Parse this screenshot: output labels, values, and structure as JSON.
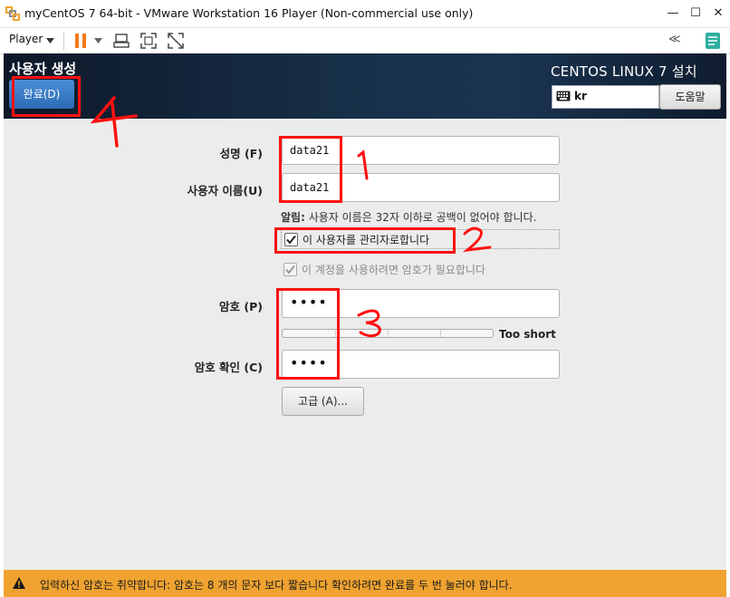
{
  "window": {
    "title": "myCentOS 7 64-bit - VMware Workstation 16 Player (Non-commercial use only)",
    "minimize": "—",
    "maximize": "☐",
    "close": "✕"
  },
  "toolbar": {
    "player_label": "Player",
    "collapse_label": "≪"
  },
  "header": {
    "title": "사용자 생성",
    "done_label": "완료(D)",
    "install_title": "CENTOS LINUX 7 설치",
    "keyboard_layout": "kr",
    "help_label": "도움말"
  },
  "form": {
    "fullname_label": "성명 (F)",
    "fullname_value": "data21",
    "username_label": "사용자 이름(U)",
    "username_value": "data21",
    "username_note_bold": "알림:",
    "username_note": " 사용자 이름은 32자 이하로 공백이 없어야 합니다.",
    "admin_label": "이 사용자를 관리자로합니다",
    "admin_checked": true,
    "require_password_label": "이 계정을 사용하려면 암호가 필요합니다",
    "require_password_checked": true,
    "password_label": "암호 (P)",
    "password_value": "••••",
    "strength_text": "Too short",
    "strength_level": 0,
    "confirm_label": "암호 확인 (C)",
    "confirm_value": "••••",
    "advanced_label": "고급 (A)..."
  },
  "warning": {
    "text": "입력하신 암호는 취약합니다: 암호는 8 개의 문자 보다 짧습니다 확인하려면 완료를 두 번 눌러야 합니다."
  },
  "annotations": {
    "marker_1": "1",
    "marker_2": "2",
    "marker_3": "3",
    "marker_4": "4",
    "color": "#ff1010"
  },
  "colors": {
    "header_dark": "#0d1828",
    "done_button": "#3a7cc8",
    "warning_bar": "#f0a330",
    "pause_icon": "#f07a1c"
  }
}
